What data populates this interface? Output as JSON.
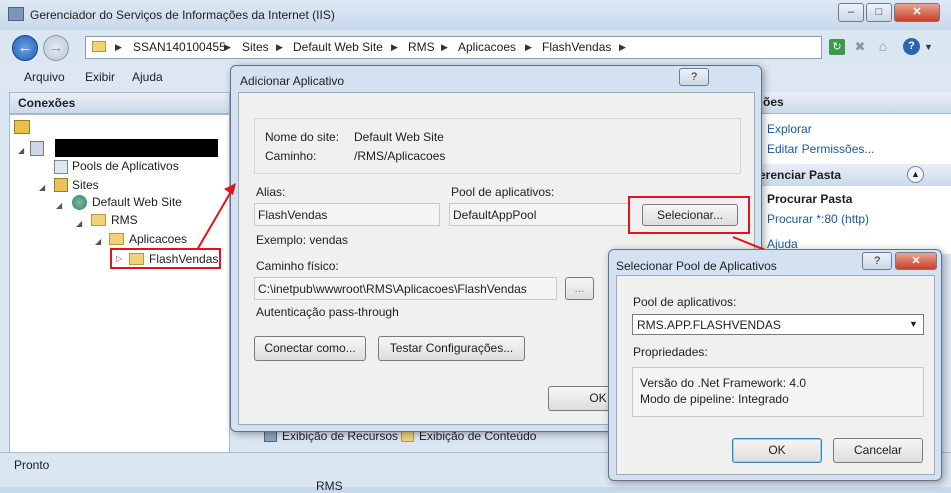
{
  "window": {
    "title": "Gerenciador do Serviços de Informações da Internet (IIS)",
    "controls": {
      "minimize": "–",
      "maximize": "□",
      "close": "✕"
    }
  },
  "address": {
    "crumbs": [
      "SSAN140100455",
      "Sites",
      "Default Web Site",
      "RMS",
      "Aplicacoes",
      "FlashVendas"
    ]
  },
  "menu": {
    "items": [
      "Arquivo",
      "Exibir",
      "Ajuda"
    ]
  },
  "connections": {
    "title": "Conexões",
    "tree": {
      "pools": "Pools de Aplicativos",
      "sites": "Sites",
      "default_site": "Default Web Site",
      "rms": "RMS",
      "aplicacoes": "Aplicacoes",
      "flashvendas": "FlashVendas"
    }
  },
  "actions": {
    "partial_header": "ões",
    "explorar": "Explorar",
    "editar": "Editar Permissões...",
    "section": "erenciar Pasta",
    "procurar": "Procurar Pasta",
    "procurar80": "Procurar *:80 (http)",
    "ajuda": "Ajuda"
  },
  "bottom_tabs": {
    "recursos": "Exibição de Recursos",
    "conteudo": "Exibição de Conteúdo"
  },
  "status": {
    "text": "Pronto",
    "partial": "RMS"
  },
  "dialog_add": {
    "title": "Adicionar Aplicativo",
    "help": "?",
    "site_label": "Nome do site:",
    "site_value": "Default Web Site",
    "path_label": "Caminho:",
    "path_value": "/RMS/Aplicacoes",
    "alias_label": "Alias:",
    "alias_value": "FlashVendas",
    "example": "Exemplo: vendas",
    "pool_label": "Pool de aplicativos:",
    "pool_value": "DefaultAppPool",
    "select_button": "Selecionar...",
    "physical_label": "Caminho físico:",
    "physical_value": "C:\\inetpub\\wwwroot\\RMS\\Aplicacoes\\FlashVendas",
    "browse_button": "...",
    "auth": "Autenticação pass-through",
    "connect_button": "Conectar como...",
    "test_button": "Testar Configurações...",
    "ok_button": "OK"
  },
  "dialog_pool": {
    "title": "Selecionar Pool de Aplicativos",
    "help": "?",
    "close": "✕",
    "pool_label": "Pool de aplicativos:",
    "pool_selected": "RMS.APP.FLASHVENDAS",
    "props_label": "Propriedades:",
    "prop1": "Versão do .Net Framework: 4.0",
    "prop2": "Modo de pipeline: Integrado",
    "ok_button": "OK",
    "cancel_button": "Cancelar"
  },
  "colors": {
    "highlight": "#e0141a",
    "link": "#1a5aa0"
  }
}
